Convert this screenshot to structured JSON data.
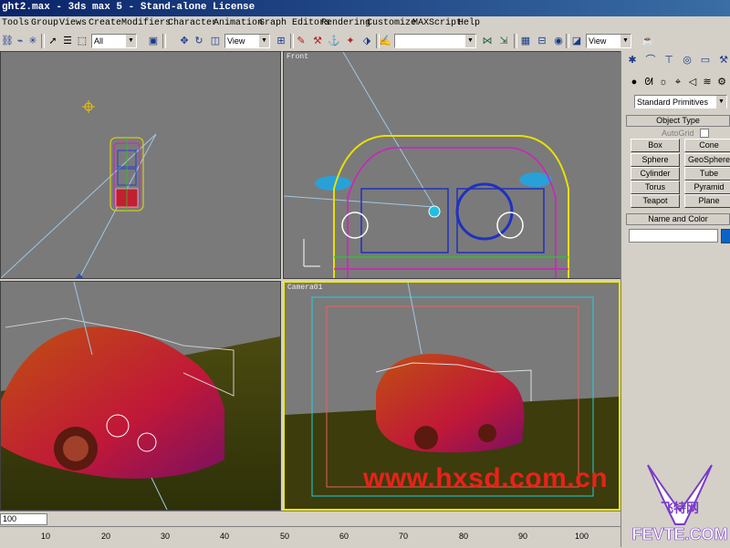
{
  "window": {
    "title": "ght2.max - 3ds max 5 - Stand-alone License"
  },
  "menu": [
    "Tools",
    "Group",
    "Views",
    "Create",
    "Modifiers",
    "Character",
    "Animation",
    "Graph Editors",
    "Rendering",
    "Customize",
    "MAXScript",
    "Help"
  ],
  "toolbar": {
    "selection_filter": "All",
    "ref_coord_left": "View",
    "named_selection": "",
    "ref_coord_right": "View",
    "icons": [
      "select-link-icon",
      "unlink-icon",
      "bind-spacewarp-icon",
      "select-icon",
      "region-select-icon",
      "move-icon",
      "rotate-icon",
      "scale-icon",
      "mirror-icon",
      "align-icon",
      "track-view-icon",
      "schematic-icon",
      "material-editor-icon",
      "render-scene-icon",
      "quick-render-icon"
    ]
  },
  "viewports": {
    "top": {
      "label": ""
    },
    "front": {
      "label": "Front"
    },
    "perspective": {
      "label": ""
    },
    "camera": {
      "label": "Camera01"
    }
  },
  "command_panel": {
    "tabs": [
      "create-tab-icon",
      "modify-tab-icon",
      "hierarchy-tab-icon",
      "motion-tab-icon",
      "display-tab-icon",
      "utilities-tab-icon"
    ],
    "category_dropdown": "Standard Primitives",
    "object_type": {
      "header": "Object Type",
      "autogrid_label": "AutoGrid",
      "buttons": [
        "Box",
        "Cone",
        "Sphere",
        "GeoSphere",
        "Cylinder",
        "Tube",
        "Torus",
        "Pyramid",
        "Teapot",
        "Plane"
      ]
    },
    "name_color": {
      "header": "Name and Color",
      "name_value": "",
      "swatch_color": "#0a64c8"
    }
  },
  "timeline": {
    "frame_display": "100",
    "ticks": [
      "10",
      "20",
      "30",
      "40",
      "50",
      "60",
      "70",
      "80",
      "90",
      "100"
    ]
  },
  "watermark": {
    "url": "www.hxsd.com.cn",
    "logo_cn": "飞特网",
    "logo_en": "FEVTE.COM"
  },
  "colors": {
    "viewport_bg": "#7a7a7a",
    "active_viewport_border": "#f0e800",
    "watermark": "#e8221a"
  }
}
